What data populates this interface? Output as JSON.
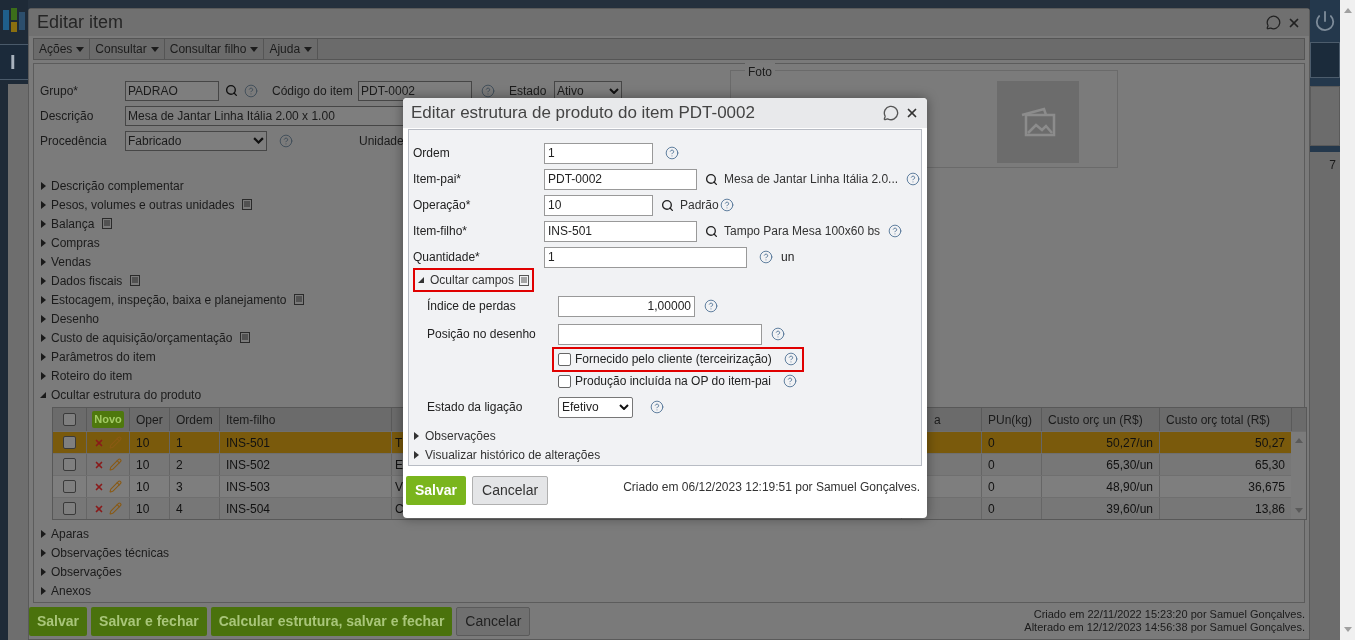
{
  "background_app": {
    "header_text": "I",
    "counter": "7"
  },
  "window": {
    "title": "Editar item"
  },
  "menu": [
    {
      "label": "Ações"
    },
    {
      "label": "Consultar"
    },
    {
      "label": "Consultar filho"
    },
    {
      "label": "Ajuda"
    }
  ],
  "form": {
    "group": {
      "label": "Grupo*",
      "value": "PADRAO"
    },
    "code": {
      "label": "Código do item",
      "value": "PDT-0002"
    },
    "state": {
      "label": "Estado",
      "value": "Ativo"
    },
    "description": {
      "label": "Descrição",
      "value": "Mesa de Jantar Linha Itália 2.00 x 1.00"
    },
    "origin": {
      "label": "Procedência",
      "value": "Fabricado"
    },
    "unit": {
      "label": "Unidade"
    }
  },
  "photo": {
    "legend": "Foto"
  },
  "sections": [
    {
      "label": "Descrição complementar",
      "expanded": false,
      "notes": false
    },
    {
      "label": "Pesos, volumes e outras unidades",
      "expanded": false,
      "notes": true
    },
    {
      "label": "Balança",
      "expanded": false,
      "notes": true
    },
    {
      "label": "Compras",
      "expanded": false,
      "notes": false
    },
    {
      "label": "Vendas",
      "expanded": false,
      "notes": false
    },
    {
      "label": "Dados fiscais",
      "expanded": false,
      "notes": true
    },
    {
      "label": "Estocagem, inspeção, baixa e planejamento",
      "expanded": false,
      "notes": true
    },
    {
      "label": "Desenho",
      "expanded": false,
      "notes": false
    },
    {
      "label": "Custo de aquisição/orçamentação",
      "expanded": false,
      "notes": true
    },
    {
      "label": "Parâmetros do item",
      "expanded": false,
      "notes": false
    },
    {
      "label": "Roteiro do item",
      "expanded": false,
      "notes": false
    },
    {
      "label": "Ocultar estrutura do produto",
      "expanded": true,
      "notes": false
    }
  ],
  "structure_table": {
    "new_button": "Novo",
    "all_checked": false,
    "columns": [
      "Oper",
      "Ordem",
      "Item-filho",
      "",
      "a",
      "PUn(kg)",
      "Custo orç un (R$)",
      "Custo orç total (R$)"
    ],
    "rows": [
      {
        "selected": true,
        "checked": false,
        "cells": [
          "10",
          "1",
          "INS-501",
          "T",
          "",
          "0",
          "50,27/un",
          "50,27"
        ]
      },
      {
        "selected": false,
        "checked": false,
        "cells": [
          "10",
          "2",
          "INS-502",
          "E",
          "",
          "0",
          "65,30/un",
          "65,30"
        ]
      },
      {
        "selected": false,
        "checked": false,
        "cells": [
          "10",
          "3",
          "INS-503",
          "V",
          "",
          "0",
          "48,90/un",
          "36,675"
        ]
      },
      {
        "selected": false,
        "checked": false,
        "cells": [
          "10",
          "4",
          "INS-504",
          "C",
          "",
          "0",
          "39,60/un",
          "13,86"
        ]
      }
    ]
  },
  "sections_after": [
    {
      "label": "Aparas",
      "expanded": false
    },
    {
      "label": "Observações técnicas",
      "expanded": false
    },
    {
      "label": "Observações",
      "expanded": false
    },
    {
      "label": "Anexos",
      "expanded": false
    }
  ],
  "footer": {
    "buttons": [
      {
        "label": "Salvar",
        "kind": "primary"
      },
      {
        "label": "Salvar e fechar",
        "kind": "primary"
      },
      {
        "label": "Calcular estrutura, salvar e fechar",
        "kind": "primary"
      },
      {
        "label": "Cancelar",
        "kind": "secondary"
      }
    ],
    "created": "Criado em 22/11/2022 15:23:20 por Samuel Gonçalves.",
    "modified": "Alterado em 12/12/2023 14:56:38 por Samuel Gonçalves."
  },
  "dialog": {
    "title": "Editar estrutura de produto do item PDT-0002",
    "fields": [
      {
        "label": "Ordem",
        "value": "1",
        "kind": "short"
      },
      {
        "label": "Item-pai*",
        "value": "PDT-0002",
        "kind": "lookup",
        "description": "Mesa de Jantar Linha Itália 2.0..."
      },
      {
        "label": "Operação*",
        "value": "10",
        "kind": "lookup_short",
        "description": "Padrão"
      },
      {
        "label": "Item-filho*",
        "value": "INS-501",
        "kind": "lookup",
        "description": "Tampo Para Mesa 100x60 bs"
      },
      {
        "label": "Quantidade*",
        "value": "1",
        "kind": "unit",
        "unit": "un"
      }
    ],
    "hidden_group": {
      "label": "Ocultar campos",
      "expanded": true,
      "highlighted": true
    },
    "loss_index": {
      "label": "Índice de perdas",
      "value": "1,00000"
    },
    "drawing_position": {
      "label": "Posição no desenho"
    },
    "checkboxes": [
      {
        "label": "Fornecido pelo cliente (terceirização)",
        "checked": false,
        "highlighted": true
      },
      {
        "label": "Produção incluída na OP do item-pai",
        "checked": false,
        "highlighted": false
      }
    ],
    "link_state": {
      "label": "Estado da ligação",
      "value": "Efetivo"
    },
    "collapsed": [
      {
        "label": "Observações",
        "expanded": false
      },
      {
        "label": "Visualizar histórico de alterações",
        "expanded": false
      }
    ],
    "buttons": [
      {
        "label": "Salvar",
        "kind": "primary"
      },
      {
        "label": "Cancelar",
        "kind": "secondary"
      }
    ],
    "created": "Criado em 06/12/2023 12:19:51 por Samuel Gonçalves."
  }
}
